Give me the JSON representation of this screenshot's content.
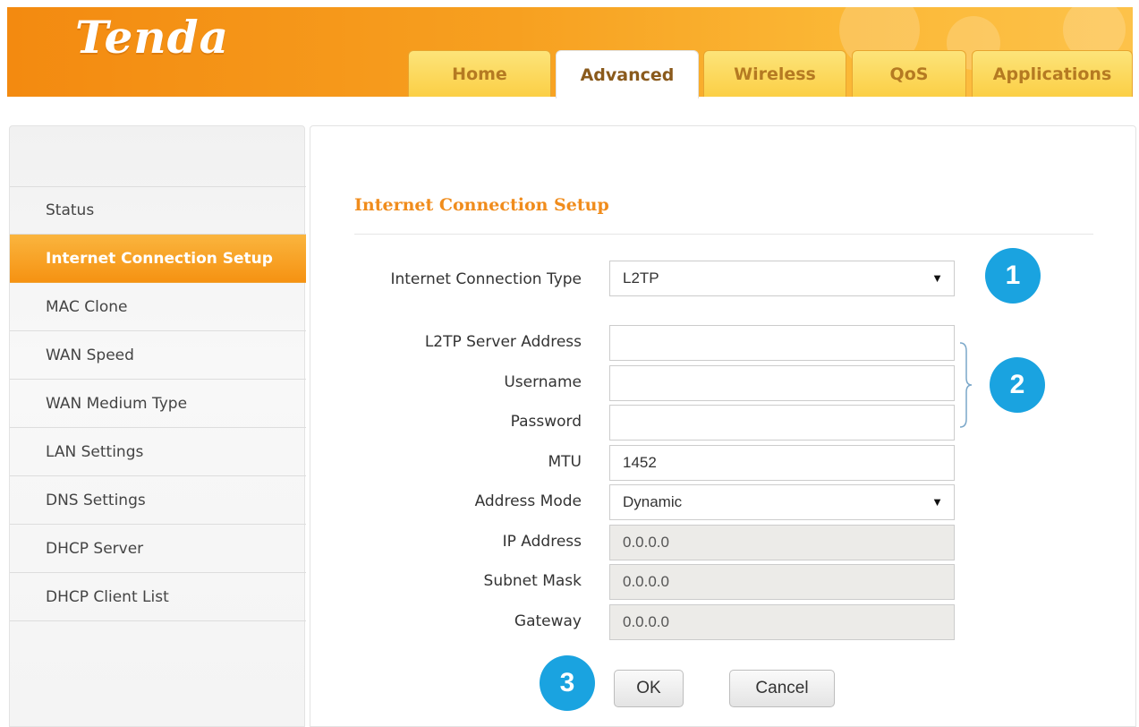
{
  "brand": {
    "logo_text": "Tenda",
    "accent": "#f69212",
    "badge_color": "#1aa3e0"
  },
  "tabs": [
    {
      "label": "Home",
      "active": false
    },
    {
      "label": "Advanced",
      "active": true
    },
    {
      "label": "Wireless",
      "active": false
    },
    {
      "label": "QoS",
      "active": false
    },
    {
      "label": "Applications",
      "active": false
    }
  ],
  "sidebar": {
    "items": [
      {
        "label": "Status",
        "active": false
      },
      {
        "label": "Internet Connection Setup",
        "active": true
      },
      {
        "label": "MAC Clone",
        "active": false
      },
      {
        "label": "WAN Speed",
        "active": false
      },
      {
        "label": "WAN Medium Type",
        "active": false
      },
      {
        "label": "LAN Settings",
        "active": false
      },
      {
        "label": "DNS Settings",
        "active": false
      },
      {
        "label": "DHCP Server",
        "active": false
      },
      {
        "label": "DHCP Client List",
        "active": false
      }
    ]
  },
  "form": {
    "title": "Internet Connection Setup",
    "connection_type": {
      "label": "Internet Connection Type",
      "value": "L2TP"
    },
    "server_address": {
      "label": "L2TP Server Address",
      "value": ""
    },
    "username": {
      "label": "Username",
      "value": ""
    },
    "password": {
      "label": "Password",
      "value": ""
    },
    "mtu": {
      "label": "MTU",
      "value": "1452"
    },
    "address_mode": {
      "label": "Address Mode",
      "value": "Dynamic"
    },
    "ip_address": {
      "label": "IP Address",
      "value": "0.0.0.0"
    },
    "subnet_mask": {
      "label": "Subnet Mask",
      "value": "0.0.0.0"
    },
    "gateway": {
      "label": "Gateway",
      "value": "0.0.0.0"
    },
    "ok_label": "OK",
    "cancel_label": "Cancel"
  },
  "steps": {
    "step1": "1",
    "step2": "2",
    "step3": "3"
  },
  "icons": {
    "dropdown": "caret-down-icon",
    "bracket": "curly-bracket-icon"
  }
}
